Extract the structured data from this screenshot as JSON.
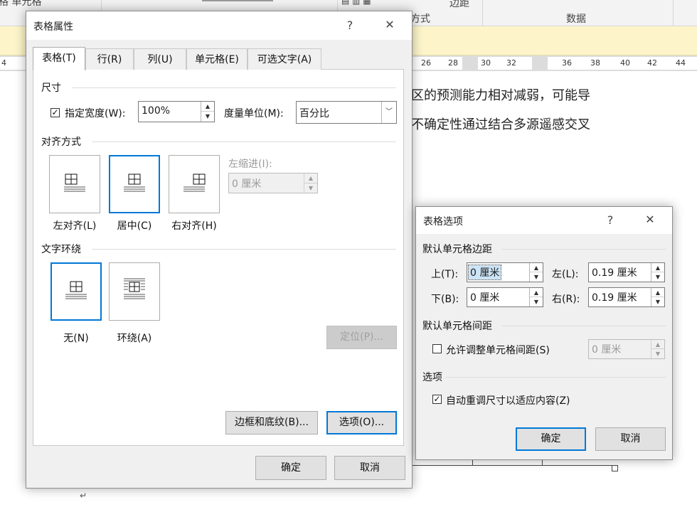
{
  "background": {
    "ribbon": {
      "label_cell": "格 单元格",
      "label_method": "方式",
      "label_margin": "边距",
      "label_data": "数据"
    },
    "ruler_numbers": [
      "4",
      "26",
      "28",
      "30",
      "32",
      "36",
      "38",
      "40",
      "42",
      "44"
    ],
    "doc_line1": "区的预测能力相对减弱，可能导",
    "doc_line2": "不确定性通过结合多源遥感交叉",
    "paragraph_mark": "↵"
  },
  "table_properties": {
    "title": "表格属性",
    "help": "?",
    "close": "✕",
    "tabs": [
      {
        "label": "表格(T)",
        "key": "T",
        "active": true
      },
      {
        "label": "行(R)",
        "key": "R"
      },
      {
        "label": "列(U)",
        "key": "U"
      },
      {
        "label": "单元格(E)",
        "key": "E"
      },
      {
        "label": "可选文字(A)",
        "key": "A"
      }
    ],
    "size": {
      "title": "尺寸",
      "checkbox_checked": true,
      "check_mark": "✓",
      "width_label": "指定宽度(W):",
      "width_value": "100%",
      "unit_label": "度量单位(M):",
      "unit_value": "百分比",
      "dropdown_glyph": "﹀"
    },
    "alignment": {
      "title": "对齐方式",
      "options": [
        {
          "label": "左对齐(L)",
          "selected": false
        },
        {
          "label": "居中(C)",
          "selected": true
        },
        {
          "label": "右对齐(H)",
          "selected": false
        }
      ],
      "indent_label": "左缩进(I):",
      "indent_value": "0 厘米"
    },
    "wrapping": {
      "title": "文字环绕",
      "options": [
        {
          "label": "无(N)",
          "selected": true
        },
        {
          "label": "环绕(A)",
          "selected": false
        }
      ],
      "position_button": "定位(P)..."
    },
    "borders_button": "边框和底纹(B)...",
    "options_button": "选项(O)...",
    "ok": "确定",
    "cancel": "取消"
  },
  "table_options": {
    "title": "表格选项",
    "help": "?",
    "close": "✕",
    "margins_title": "默认单元格边距",
    "top_label": "上(T):",
    "top_value": "0 厘米",
    "bottom_label": "下(B):",
    "bottom_value": "0 厘米",
    "left_label": "左(L):",
    "left_value": "0.19 厘米",
    "right_label": "右(R):",
    "right_value": "0.19 厘米",
    "spacing_title": "默认单元格间距",
    "allow_spacing_label": "允许调整单元格间距(S)",
    "allow_spacing_checked": false,
    "spacing_value": "0 厘米",
    "options_title": "选项",
    "autoresize_label": "自动重调尺寸以适应内容(Z)",
    "autoresize_checked": true,
    "check_mark": "✓",
    "ok": "确定",
    "cancel": "取消"
  },
  "arrow_up": "▲",
  "arrow_down": "▼"
}
